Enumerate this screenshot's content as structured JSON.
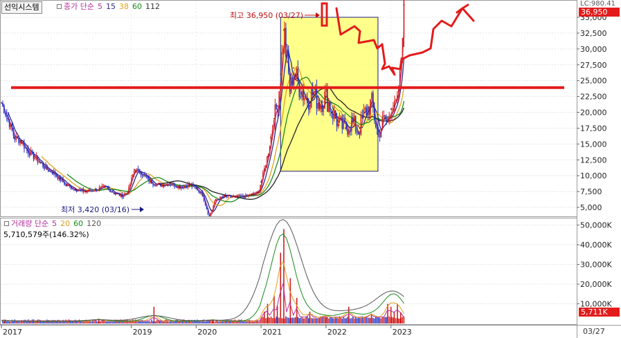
{
  "stock_name": "선익시스템",
  "price_legend": {
    "label": "종가 단순",
    "ma": [
      "5",
      "15",
      "38",
      "60",
      "112"
    ]
  },
  "volume_legend": {
    "label": "거래량 단순",
    "ma": [
      "5",
      "20",
      "60",
      "120"
    ]
  },
  "volume_info": "5,710,579주(146.32%)",
  "lc_label": "LC:980.41",
  "last_price_label": "36,950",
  "last_volume_label": "5,711K",
  "high_label": "최고 36,950 (03/27)",
  "low_label": "최저 3,420 (03/16)",
  "date_right_label": "03/27",
  "colors": {
    "up": "#d21e1e",
    "down": "#2232c8",
    "ma5": "#b4309a",
    "ma15": "#2a2a88",
    "ma38": "#e0a020",
    "ma60": "#1a8a1a",
    "ma112": "#222222",
    "vma5": "#b4309a",
    "vma20": "#e0a020",
    "vma60": "#1a8a1a",
    "vma120": "#555555",
    "annotation_red": "#e31b1b",
    "highlight_box": "#ffff66"
  },
  "chart_data": [
    {
      "type": "line",
      "title": "선익시스템",
      "y_ticks": [
        "5,000",
        "7,500",
        "10,000",
        "12,500",
        "15,000",
        "17,500",
        "20,000",
        "22,500",
        "25,000",
        "27,500",
        "30,000",
        "32,500",
        "35,000"
      ],
      "ylim": [
        2500,
        37500
      ],
      "x_ticks": [
        "2017",
        "2019",
        "2020",
        "2021",
        "2022",
        "2023"
      ],
      "x_tick_years": [
        2017.0,
        2019.0,
        2020.0,
        2021.0,
        2022.0,
        2023.0
      ],
      "xlim": [
        2017.0,
        2024.0
      ],
      "series": [
        {
          "kind": "price",
          "x": [
            2017.0,
            2017.1,
            2017.2,
            2017.3,
            2017.4,
            2017.5,
            2017.6,
            2017.7,
            2017.8,
            2017.9,
            2018.0,
            2018.15,
            2018.3,
            2018.45,
            2018.6,
            2018.75,
            2018.85,
            2018.95,
            2019.05,
            2019.15,
            2019.3,
            2019.45,
            2019.6,
            2019.75,
            2019.9,
            2020.0,
            2020.1,
            2020.2,
            2020.3,
            2020.45,
            2020.6,
            2020.75,
            2020.85,
            2020.95,
            2021.0,
            2021.05,
            2021.1,
            2021.15,
            2021.2,
            2021.25,
            2021.3,
            2021.35,
            2021.4,
            2021.45,
            2021.5,
            2021.55,
            2021.6,
            2021.7,
            2021.8,
            2021.9,
            2022.0,
            2022.1,
            2022.2,
            2022.3,
            2022.4,
            2022.5,
            2022.6,
            2022.7,
            2022.8,
            2022.9,
            2022.95,
            2023.0,
            2023.05,
            2023.1,
            2023.15,
            2023.2
          ],
          "values": [
            21500,
            19000,
            16000,
            15500,
            14000,
            13000,
            12000,
            11000,
            10500,
            9500,
            8500,
            7800,
            7500,
            7800,
            8200,
            7200,
            6800,
            7500,
            11000,
            10500,
            9000,
            8500,
            8800,
            8200,
            8600,
            8000,
            7000,
            3420,
            6200,
            6800,
            6600,
            6700,
            7000,
            7300,
            9000,
            11000,
            13000,
            16000,
            19000,
            21000,
            26000,
            33000,
            28000,
            23000,
            27000,
            25000,
            24000,
            22000,
            23000,
            21500,
            22500,
            20000,
            18000,
            17500,
            18500,
            17000,
            20000,
            21500,
            16500,
            19000,
            18500,
            20500,
            21000,
            22000,
            27000,
            36950
          ]
        }
      ],
      "annotations": {
        "high": {
          "x": 2023.15,
          "value": 36950
        },
        "low": {
          "x": 2020.2,
          "value": 3420
        },
        "horizontal_line_value": 23900,
        "highlight_box": {
          "x": [
            2021.3,
            2022.8
          ],
          "y": [
            10700,
            35000
          ]
        }
      }
    },
    {
      "type": "bar",
      "title": "거래량",
      "y_ticks": [
        "10,000K",
        "20,000K",
        "30,000K",
        "40,000K",
        "50,000K"
      ],
      "ylim": [
        0,
        52000
      ],
      "x": [
        2017.05,
        2018.5,
        2019.35,
        2020.25,
        2021.05,
        2021.1,
        2021.2,
        2021.25,
        2021.3,
        2021.35,
        2021.45,
        2021.55,
        2021.75,
        2022.0,
        2022.35,
        2022.7,
        2022.95,
        2023.0,
        2023.05,
        2023.1,
        2023.15
      ],
      "values": [
        1200,
        2500,
        8500,
        1800,
        6000,
        10000,
        14000,
        9000,
        36000,
        48000,
        23000,
        13000,
        6000,
        3000,
        8500,
        5000,
        10000,
        8500,
        6000,
        10000,
        5711
      ]
    }
  ]
}
